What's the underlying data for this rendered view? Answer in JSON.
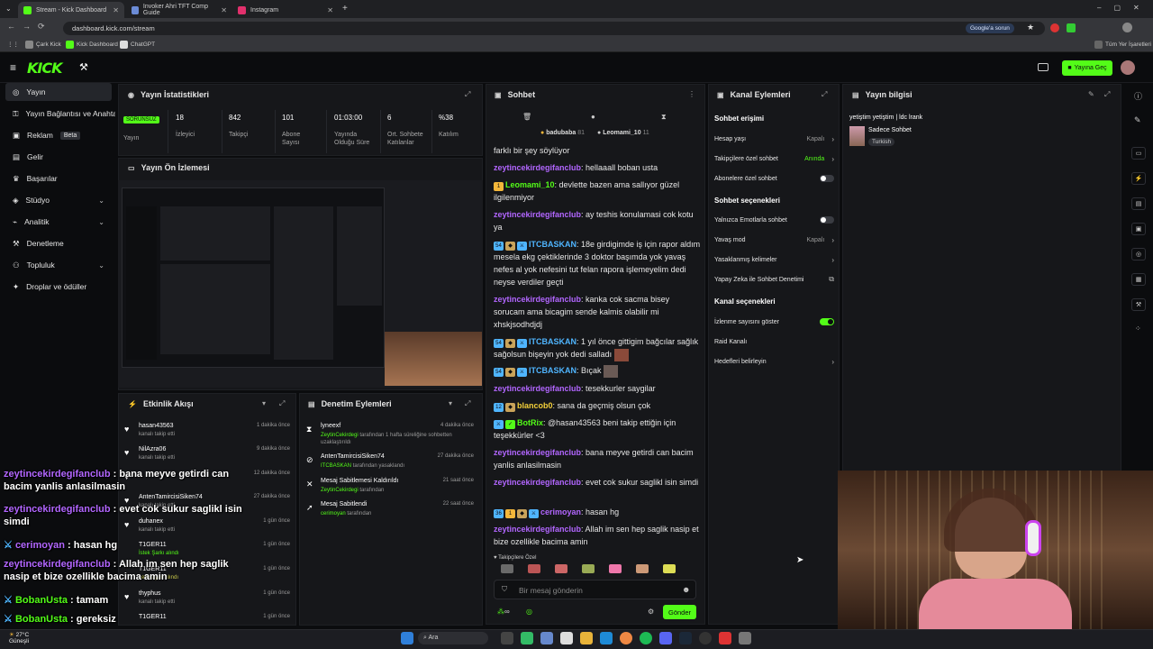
{
  "browser": {
    "tabs": [
      {
        "label": "Stream - Kick Dashboard",
        "active": true
      },
      {
        "label": "Invoker Ahri TFT Comp Guide",
        "active": false
      },
      {
        "label": "Instagram",
        "active": false
      }
    ],
    "url": "dashboard.kick.com/stream",
    "google_btn": "Google'a sorun",
    "bookmarks": [
      "Çark Kick",
      "Kick Dashboard",
      "ChatGPT"
    ],
    "all_bookmarks": "Tüm Yer İşaretleri"
  },
  "topbar": {
    "logo": "KICK",
    "live_button": "Yayına Geç"
  },
  "sidebar": {
    "items": [
      {
        "label": "Yayın",
        "icon": "target-icon"
      },
      {
        "label": "Yayın Bağlantısı ve Anahtarı",
        "icon": "key-icon"
      },
      {
        "label": "Reklam",
        "icon": "ad-icon",
        "badge": "Beta"
      },
      {
        "label": "Gelir",
        "icon": "money-icon"
      },
      {
        "label": "Başarılar",
        "icon": "trophy-icon"
      },
      {
        "label": "Stüdyo",
        "icon": "studio-icon"
      },
      {
        "label": "Analitik",
        "icon": "chart-icon"
      },
      {
        "label": "Denetleme",
        "icon": "hammer-icon"
      },
      {
        "label": "Topluluk",
        "icon": "people-icon"
      },
      {
        "label": "Droplar ve ödüller",
        "icon": "gift-icon"
      }
    ]
  },
  "stats": {
    "title": "Yayın İstatistikleri",
    "status": "SORUNSUZ",
    "cells": [
      {
        "value": "",
        "label": "Yayın"
      },
      {
        "value": "18",
        "label": "İzleyici"
      },
      {
        "value": "842",
        "label": "Takipçi"
      },
      {
        "value": "101",
        "label": "Abone Sayısı"
      },
      {
        "value": "01:03:00",
        "label": "Yayında Olduğu Süre"
      },
      {
        "value": "6",
        "label": "Ort. Sohbete Katılanlar"
      },
      {
        "value": "%38",
        "label": "Katılım"
      }
    ]
  },
  "preview": {
    "title": "Yayın Ön İzlemesi"
  },
  "activity": {
    "title": "Etkinlik Akışı",
    "rows": [
      {
        "name": "hasan43563",
        "sub": "kanalı takip etti",
        "time": "1 dakika önce"
      },
      {
        "name": "NilAzra06",
        "sub": "kanalı takip etti",
        "time": "9 dakika önce"
      },
      {
        "name": "",
        "sub": "",
        "time": "12 dakika önce"
      },
      {
        "name": "AntenTamircisiSiken74",
        "sub": "kanalı takip etti",
        "time": "27 dakika önce"
      },
      {
        "name": "duhanex",
        "sub": "kanalı takip etti",
        "time": "1 gün önce"
      },
      {
        "name": "T1GER11",
        "sub": "İstek Şarkı alındı",
        "time": "1 gün önce"
      },
      {
        "name": "T1GER11",
        "sub": "cerimoyan alındı",
        "time": "1 gün önce"
      },
      {
        "name": "thyphus",
        "sub": "kanalı takip etti",
        "time": "1 gün önce"
      },
      {
        "name": "T1GER11",
        "sub": "",
        "time": "1 gün önce"
      }
    ]
  },
  "moderation": {
    "title": "Denetim Eylemleri",
    "rows": [
      {
        "name": "lyneexf",
        "actor": "ZeytinCekirdegi",
        "sub": "tarafından 1 hafta süreliğine sohbetten uzaklaştırıldı",
        "time": "4 dakika önce",
        "icon": "hourglass-icon"
      },
      {
        "name": "AntenTamircisiSiken74",
        "actor": "ITCBASKAN",
        "sub": "tarafından yasaklandı",
        "time": "27 dakika önce",
        "icon": "ban-icon"
      },
      {
        "name": "Mesaj Sabitlemesi Kaldırıldı",
        "actor": "ZeytinCekirdegi",
        "sub": "tarafından",
        "time": "21 saat önce",
        "icon": "unpin-icon"
      },
      {
        "name": "Mesaj Sabitlendi",
        "actor": "cerimoyan",
        "sub": "tarafından",
        "time": "22 saat önce",
        "icon": "pin-icon"
      }
    ]
  },
  "chat": {
    "title": "Sohbet",
    "pinned_users": [
      {
        "name": "badubaba",
        "count": "81"
      },
      {
        "name": "Leomami_10",
        "count": "11"
      }
    ],
    "messages": [
      {
        "user": "",
        "text": "farklı bir şey söylüyor"
      },
      {
        "user": "zeytincekirdegifanclub",
        "text": "hellaaall boban usta"
      },
      {
        "user": "Leomami_10",
        "text": "devlette bazen ama sallıyor güzel ilgilenmiyor"
      },
      {
        "user": "zeytincekirdegifanclub",
        "text": "ay teshis konulamasi cok kotu ya"
      },
      {
        "user": "ITCBASKAN",
        "text": "18e girdigimde iş için rapor aldım mesela ekg çektiklerinde 3 doktor başımda yok yavaş nefes al yok nefesini tut felan rapora işlemeyelim dedi neyse verdiler geçti"
      },
      {
        "user": "zeytincekirdegifanclub",
        "text": "kanka cok sacma bisey sorucam ama bicagim sende kalmis olabilir mi xhskjsodhdjdj"
      },
      {
        "user": "ITCBASKAN",
        "text": "1 yıl önce gittigim bağcılar sağlık sağolsun bişeyin yok dedi salladı"
      },
      {
        "user": "ITCBASKAN",
        "text": "Bıçak"
      },
      {
        "user": "zeytincekirdegifanclub",
        "text": "tesekkurler saygilar"
      },
      {
        "user": "blancob0",
        "text": "sana da geçmiş olsun çok"
      },
      {
        "user": "BotRix",
        "text": "@hasan43563 beni takip ettiğin için teşekkürler <3"
      },
      {
        "user": "zeytincekirdegifanclub",
        "text": "bana meyve getirdi can bacim yanlis anlasilmasin"
      },
      {
        "user": "zeytincekirdegifanclub",
        "text": "evet cok sukur saglikl isin simdi"
      },
      {
        "user": "cerimoyan",
        "text": "hasan hg"
      },
      {
        "user": "zeytincekirdegifanclub",
        "text": "Allah im sen hep saglik nasip et bize ozellikle bacima amin"
      }
    ],
    "followers_only": "Takipçilere Özel",
    "input_placeholder": "Bir mesaj gönderin",
    "send": "Gönder",
    "infinity": "∞"
  },
  "channel": {
    "title": "Kanal Eylemleri",
    "sections": [
      {
        "title": "Sohbet erişimi",
        "rows": [
          {
            "label": "Hesap yaşı",
            "value": "Kapalı",
            "kind": "arrow"
          },
          {
            "label": "Takipçilere özel sohbet",
            "value": "Anında",
            "kind": "arrow"
          },
          {
            "label": "Abonelere özel sohbet",
            "value": "",
            "kind": "toggle-off"
          }
        ]
      },
      {
        "title": "Sohbet seçenekleri",
        "rows": [
          {
            "label": "Yalnızca Emotlarla sohbet",
            "value": "",
            "kind": "toggle-off"
          },
          {
            "label": "Yavaş mod",
            "value": "Kapalı",
            "kind": "arrow"
          },
          {
            "label": "Yasaklanmış kelimeler",
            "value": "",
            "kind": "arrow"
          },
          {
            "label": "Yapay Zeka ile Sohbet Denetimi",
            "value": "",
            "kind": "external"
          }
        ]
      },
      {
        "title": "Kanal seçenekleri",
        "rows": [
          {
            "label": "İzlenme sayısını göster",
            "value": "",
            "kind": "toggle-on"
          },
          {
            "label": "Raid Kanalı",
            "value": "",
            "kind": "none"
          },
          {
            "label": "Hedefleri belirleyin",
            "value": "",
            "kind": "arrow"
          }
        ]
      }
    ]
  },
  "stream_info": {
    "title": "Yayın bilgisi",
    "stream_title": "yetiştim yetiştim | ldc lrank",
    "category": "Sadece Sohbet",
    "language": "Turkish"
  },
  "overlay_chat": [
    {
      "user": "zeytincekirdegifanclub",
      "text": "bana meyve getirdi can bacim yanlis anlasilmasin"
    },
    {
      "user": "zeytincekirdegifanclub",
      "text": "evet cok sukur saglikl isin simdi"
    },
    {
      "user": "cerimoyan",
      "text": "hasan hg"
    },
    {
      "user": "zeytincekirdegifanclub",
      "text": "Allah im sen hep saglik nasip et bize ozellikle bacima amin"
    },
    {
      "user": "BobanUsta",
      "text": "tamam"
    },
    {
      "user": "BobanUsta",
      "text": "gereksiz"
    }
  ],
  "taskbar": {
    "weather_temp": "27°C",
    "weather_desc": "Güneşli",
    "search": "Ara"
  },
  "colors": {
    "accent": "#53fc18",
    "chat_purple": "#b266ff",
    "chat_blue": "#4fb5ff"
  }
}
